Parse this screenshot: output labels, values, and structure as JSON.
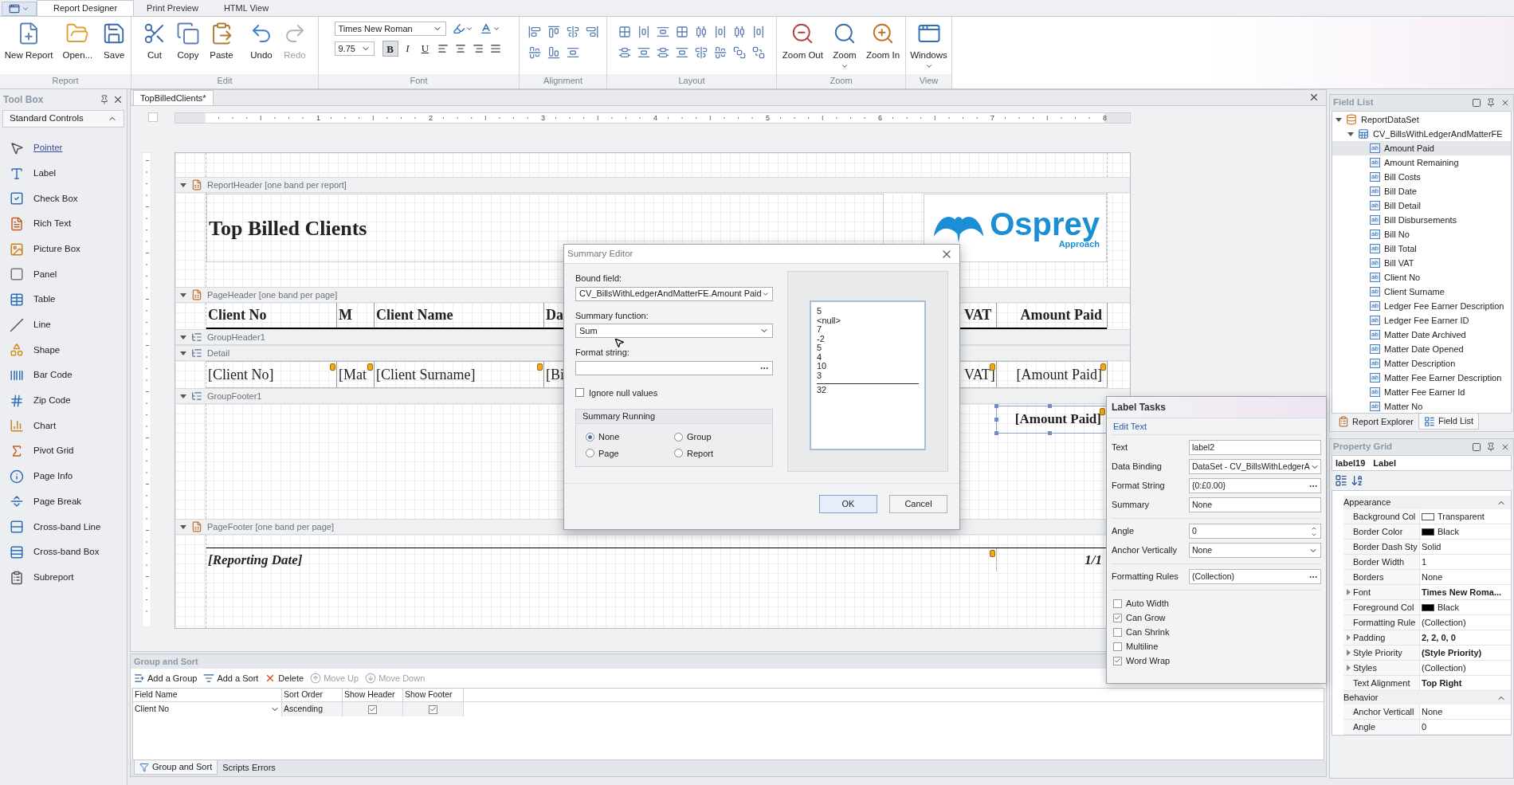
{
  "ribbon": {
    "tabs": [
      {
        "label": "Report Designer",
        "selected": true
      },
      {
        "label": "Print Preview",
        "selected": false
      },
      {
        "label": "HTML View",
        "selected": false
      }
    ],
    "groups": [
      {
        "kind": "buttons",
        "label": "Report",
        "buttons": [
          {
            "label": "New Report",
            "disabled": false,
            "dropdown": false
          },
          {
            "label": "Open...",
            "disabled": false,
            "dropdown": false
          },
          {
            "label": "Save",
            "disabled": false,
            "dropdown": false
          }
        ]
      },
      {
        "kind": "buttons",
        "label": "Edit",
        "buttons": [
          {
            "label": "Cut",
            "disabled": false,
            "dropdown": false
          },
          {
            "label": "Copy",
            "disabled": false,
            "dropdown": false
          },
          {
            "label": "Paste",
            "disabled": false,
            "dropdown": false
          },
          {
            "label": "Undo",
            "disabled": false,
            "dropdown": false
          },
          {
            "label": "Redo",
            "disabled": true,
            "dropdown": false
          }
        ]
      },
      {
        "kind": "font",
        "label": "Font",
        "font_name": "Times New Roman",
        "font_size": "9.75",
        "styles": [
          {
            "label": "B",
            "selected": true
          },
          {
            "label": "I",
            "selected": false
          },
          {
            "label": "U",
            "selected": false
          }
        ]
      },
      {
        "kind": "alignment",
        "label": "Alignment"
      },
      {
        "kind": "layout",
        "label": "Layout"
      },
      {
        "kind": "buttons",
        "label": "Zoom",
        "buttons": [
          {
            "label": "Zoom Out",
            "disabled": false,
            "dropdown": false
          },
          {
            "label": "Zoom",
            "disabled": false,
            "dropdown": true
          },
          {
            "label": "Zoom In",
            "disabled": false,
            "dropdown": false
          }
        ]
      },
      {
        "kind": "buttons",
        "label": "View",
        "buttons": [
          {
            "label": "Windows",
            "disabled": false,
            "dropdown": true
          }
        ]
      }
    ]
  },
  "toolbox": {
    "title": "Tool Box",
    "section": {
      "label": "Standard Controls",
      "expanded": true
    },
    "items": [
      {
        "label": "Pointer",
        "selected": true
      },
      {
        "label": "Label",
        "selected": false
      },
      {
        "label": "Check Box",
        "selected": false
      },
      {
        "label": "Rich Text",
        "selected": false
      },
      {
        "label": "Picture Box",
        "selected": false
      },
      {
        "label": "Panel",
        "selected": false
      },
      {
        "label": "Table",
        "selected": false
      },
      {
        "label": "Line",
        "selected": false
      },
      {
        "label": "Shape",
        "selected": false
      },
      {
        "label": "Bar Code",
        "selected": false
      },
      {
        "label": "Zip Code",
        "selected": false
      },
      {
        "label": "Chart",
        "selected": false
      },
      {
        "label": "Pivot Grid",
        "selected": false
      },
      {
        "label": "Page Info",
        "selected": false
      },
      {
        "label": "Page Break",
        "selected": false
      },
      {
        "label": "Cross-band Line",
        "selected": false
      },
      {
        "label": "Cross-band Box",
        "selected": false
      },
      {
        "label": "Subreport",
        "selected": false
      }
    ]
  },
  "document_tab": "TopBilledClients*",
  "ruler": [
    "1",
    "2",
    "3",
    "4",
    "5",
    "6",
    "7",
    "8"
  ],
  "bands": [
    {
      "kind": "report_header",
      "label": "ReportHeader [one band per report]",
      "expanded": true,
      "title": "Top Billed Clients",
      "logo": {
        "name": "Osprey",
        "tagline": "Approach"
      }
    },
    {
      "kind": "page_header",
      "label": "PageHeader [one band per page]",
      "expanded": true,
      "cells": [
        {
          "text": "Client No"
        },
        {
          "text": "M"
        },
        {
          "text": "Client Name"
        },
        {
          "text": "Da"
        },
        {
          "text": "VAT"
        },
        {
          "text": "Amount Paid"
        }
      ]
    },
    {
      "kind": "group_header",
      "label": "GroupHeader1",
      "expanded": true
    },
    {
      "kind": "detail",
      "label": "Detail",
      "expanded": true,
      "cells": [
        {
          "text": "[Client No]",
          "tag": true
        },
        {
          "text": "[Mat",
          "tag": true
        },
        {
          "text": "[Client Surname]",
          "tag": true
        },
        {
          "text": "[Bi",
          "tag": false
        },
        {
          "text": "VAT]",
          "tag": true
        },
        {
          "text": "[Amount Paid]",
          "tag": true
        }
      ]
    },
    {
      "kind": "group_footer",
      "label": "GroupFooter1",
      "expanded": true,
      "field": {
        "text": "[Amount Paid]",
        "selected": true
      }
    },
    {
      "kind": "page_footer",
      "label": "PageFooter [one band per page]",
      "expanded": true,
      "left": "[Reporting Date]",
      "right": "1/1"
    }
  ],
  "summary_editor": {
    "title": "Summary Editor",
    "bound_field": {
      "label": "Bound field:",
      "value": "CV_BillsWithLedgerAndMatterFE.Amount Paid"
    },
    "function": {
      "label": "Summary function:",
      "value": "Sum"
    },
    "format": {
      "label": "Format string:"
    },
    "ignore_nulls": {
      "label": "Ignore null values",
      "checked": false
    },
    "running": {
      "label": "Summary Running",
      "options": [
        {
          "label": "None",
          "selected": true
        },
        {
          "label": "Group",
          "selected": false
        },
        {
          "label": "Page",
          "selected": false
        },
        {
          "label": "Report",
          "selected": false
        }
      ]
    },
    "preview": [
      "5",
      "<null>",
      "7",
      "-2",
      "5",
      "4",
      "10",
      "3"
    ],
    "total": "32",
    "buttons": [
      "OK",
      "Cancel"
    ]
  },
  "label_tasks": {
    "title": "Label Tasks",
    "link": "Edit Text",
    "sections": [
      {
        "fields": [
          {
            "label": "Text",
            "kind": "text",
            "value": "label2"
          },
          {
            "label": "Data Binding",
            "kind": "dropdown",
            "value": "DataSet - CV_BillsWithLedgerA"
          },
          {
            "label": "Format String",
            "kind": "browse",
            "value": "{0:£0.00}"
          },
          {
            "label": "Summary",
            "kind": "text",
            "value": "None"
          }
        ]
      },
      {
        "fields": [
          {
            "label": "Angle",
            "kind": "spin",
            "value": "0"
          },
          {
            "label": "Anchor Vertically",
            "kind": "dropdown",
            "value": "None"
          }
        ]
      },
      {
        "fields": [
          {
            "label": "Formatting Rules",
            "kind": "browse",
            "value": "(Collection)"
          }
        ]
      }
    ],
    "options": [
      {
        "label": "Auto Width",
        "checked": false
      },
      {
        "label": "Can Grow",
        "checked": true
      },
      {
        "label": "Can Shrink",
        "checked": false
      },
      {
        "label": "Multiline",
        "checked": false
      },
      {
        "label": "Word Wrap",
        "checked": true
      }
    ]
  },
  "group_sort": {
    "title": "Group and Sort",
    "toolbar": [
      {
        "label": "Add a Group",
        "disabled": false
      },
      {
        "label": "Add a Sort",
        "disabled": false
      },
      {
        "label": "Delete",
        "disabled": false
      },
      {
        "label": "Move Up",
        "disabled": true
      },
      {
        "label": "Move Down",
        "disabled": true
      }
    ],
    "columns": [
      "Field Name",
      "Sort Order",
      "Show Header",
      "Show Footer"
    ],
    "rows": [
      {
        "field": "Client No",
        "order": "Ascending",
        "show_header": true,
        "show_footer": true
      }
    ],
    "tabs": [
      {
        "label": "Group and Sort",
        "selected": true
      },
      {
        "label": "Scripts Errors",
        "selected": false
      }
    ]
  },
  "field_list": {
    "title": "Field List",
    "tree": [
      {
        "kind": "dataset",
        "label": "ReportDataSet",
        "expanded": true,
        "children": [
          {
            "kind": "table",
            "label": "CV_BillsWithLedgerAndMatterFE",
            "expanded": true,
            "children": [
              {
                "kind": "field",
                "badge": "ab",
                "label": "Amount Paid",
                "selected": true
              },
              {
                "kind": "field",
                "badge": "ab",
                "label": "Amount Remaining",
                "selected": false
              },
              {
                "kind": "field",
                "badge": "ab",
                "label": "Bill Costs",
                "selected": false
              },
              {
                "kind": "field",
                "badge": "ab",
                "label": "Bill Date",
                "selected": false
              },
              {
                "kind": "field",
                "badge": "ab",
                "label": "Bill Detail",
                "selected": false
              },
              {
                "kind": "field",
                "badge": "ab",
                "label": "Bill Disbursements",
                "selected": false
              },
              {
                "kind": "field",
                "badge": "ab",
                "label": "Bill No",
                "selected": false
              },
              {
                "kind": "field",
                "badge": "ab",
                "label": "Bill Total",
                "selected": false
              },
              {
                "kind": "field",
                "badge": "ab",
                "label": "Bill VAT",
                "selected": false
              },
              {
                "kind": "field",
                "badge": "ab",
                "label": "Client No",
                "selected": false
              },
              {
                "kind": "field",
                "badge": "ab",
                "label": "Client Surname",
                "selected": false
              },
              {
                "kind": "field",
                "badge": "ab",
                "label": "Ledger Fee Earner Description",
                "selected": false
              },
              {
                "kind": "field",
                "badge": "ab",
                "label": "Ledger Fee Earner ID",
                "selected": false
              },
              {
                "kind": "field",
                "badge": "ab",
                "label": "Matter Date Archived",
                "selected": false
              },
              {
                "kind": "field",
                "badge": "ab",
                "label": "Matter Date Opened",
                "selected": false
              },
              {
                "kind": "field",
                "badge": "ab",
                "label": "Matter Description",
                "selected": false
              },
              {
                "kind": "field",
                "badge": "ab",
                "label": "Matter Fee Earner Description",
                "selected": false
              },
              {
                "kind": "field",
                "badge": "ab",
                "label": "Matter Fee Earner Id",
                "selected": false
              },
              {
                "kind": "field",
                "badge": "ab",
                "label": "Matter No",
                "selected": false
              }
            ]
          }
        ]
      }
    ],
    "tabs": [
      {
        "label": "Report Explorer",
        "selected": false
      },
      {
        "label": "Field List",
        "selected": true
      }
    ]
  },
  "property_grid": {
    "title": "Property Grid",
    "object": "label19",
    "type": "Label",
    "categories": [
      {
        "label": "Appearance",
        "expanded": true,
        "rows": [
          {
            "name": "Background Col",
            "value": "Transparent",
            "color": "#ffffff",
            "bold": false,
            "expandable": false
          },
          {
            "name": "Border Color",
            "value": "Black",
            "color": "#000000",
            "bold": false,
            "expandable": false
          },
          {
            "name": "Border Dash Sty",
            "value": "Solid",
            "bold": false,
            "expandable": false
          },
          {
            "name": "Border Width",
            "value": "1",
            "bold": false,
            "expandable": false
          },
          {
            "name": "Borders",
            "value": "None",
            "bold": false,
            "expandable": false
          },
          {
            "name": "Font",
            "value": "Times New Roma...",
            "bold": true,
            "expandable": true
          },
          {
            "name": "Foreground Col",
            "value": "Black",
            "color": "#000000",
            "bold": false,
            "expandable": false
          },
          {
            "name": "Formatting Rule",
            "value": "(Collection)",
            "bold": false,
            "expandable": false
          },
          {
            "name": "Padding",
            "value": "2, 2, 0, 0",
            "bold": true,
            "expandable": true
          },
          {
            "name": "Style Priority",
            "value": "(Style Priority)",
            "bold": true,
            "expandable": true
          },
          {
            "name": "Styles",
            "value": "(Collection)",
            "bold": false,
            "expandable": true
          },
          {
            "name": "Text Alignment",
            "value": "Top Right",
            "bold": true,
            "expandable": false
          }
        ]
      },
      {
        "label": "Behavior",
        "expanded": true,
        "rows": [
          {
            "name": "Anchor Verticall",
            "value": "None",
            "bold": false,
            "expandable": false
          },
          {
            "name": "Angle",
            "value": "0",
            "bold": false,
            "expandable": false
          }
        ]
      }
    ]
  }
}
